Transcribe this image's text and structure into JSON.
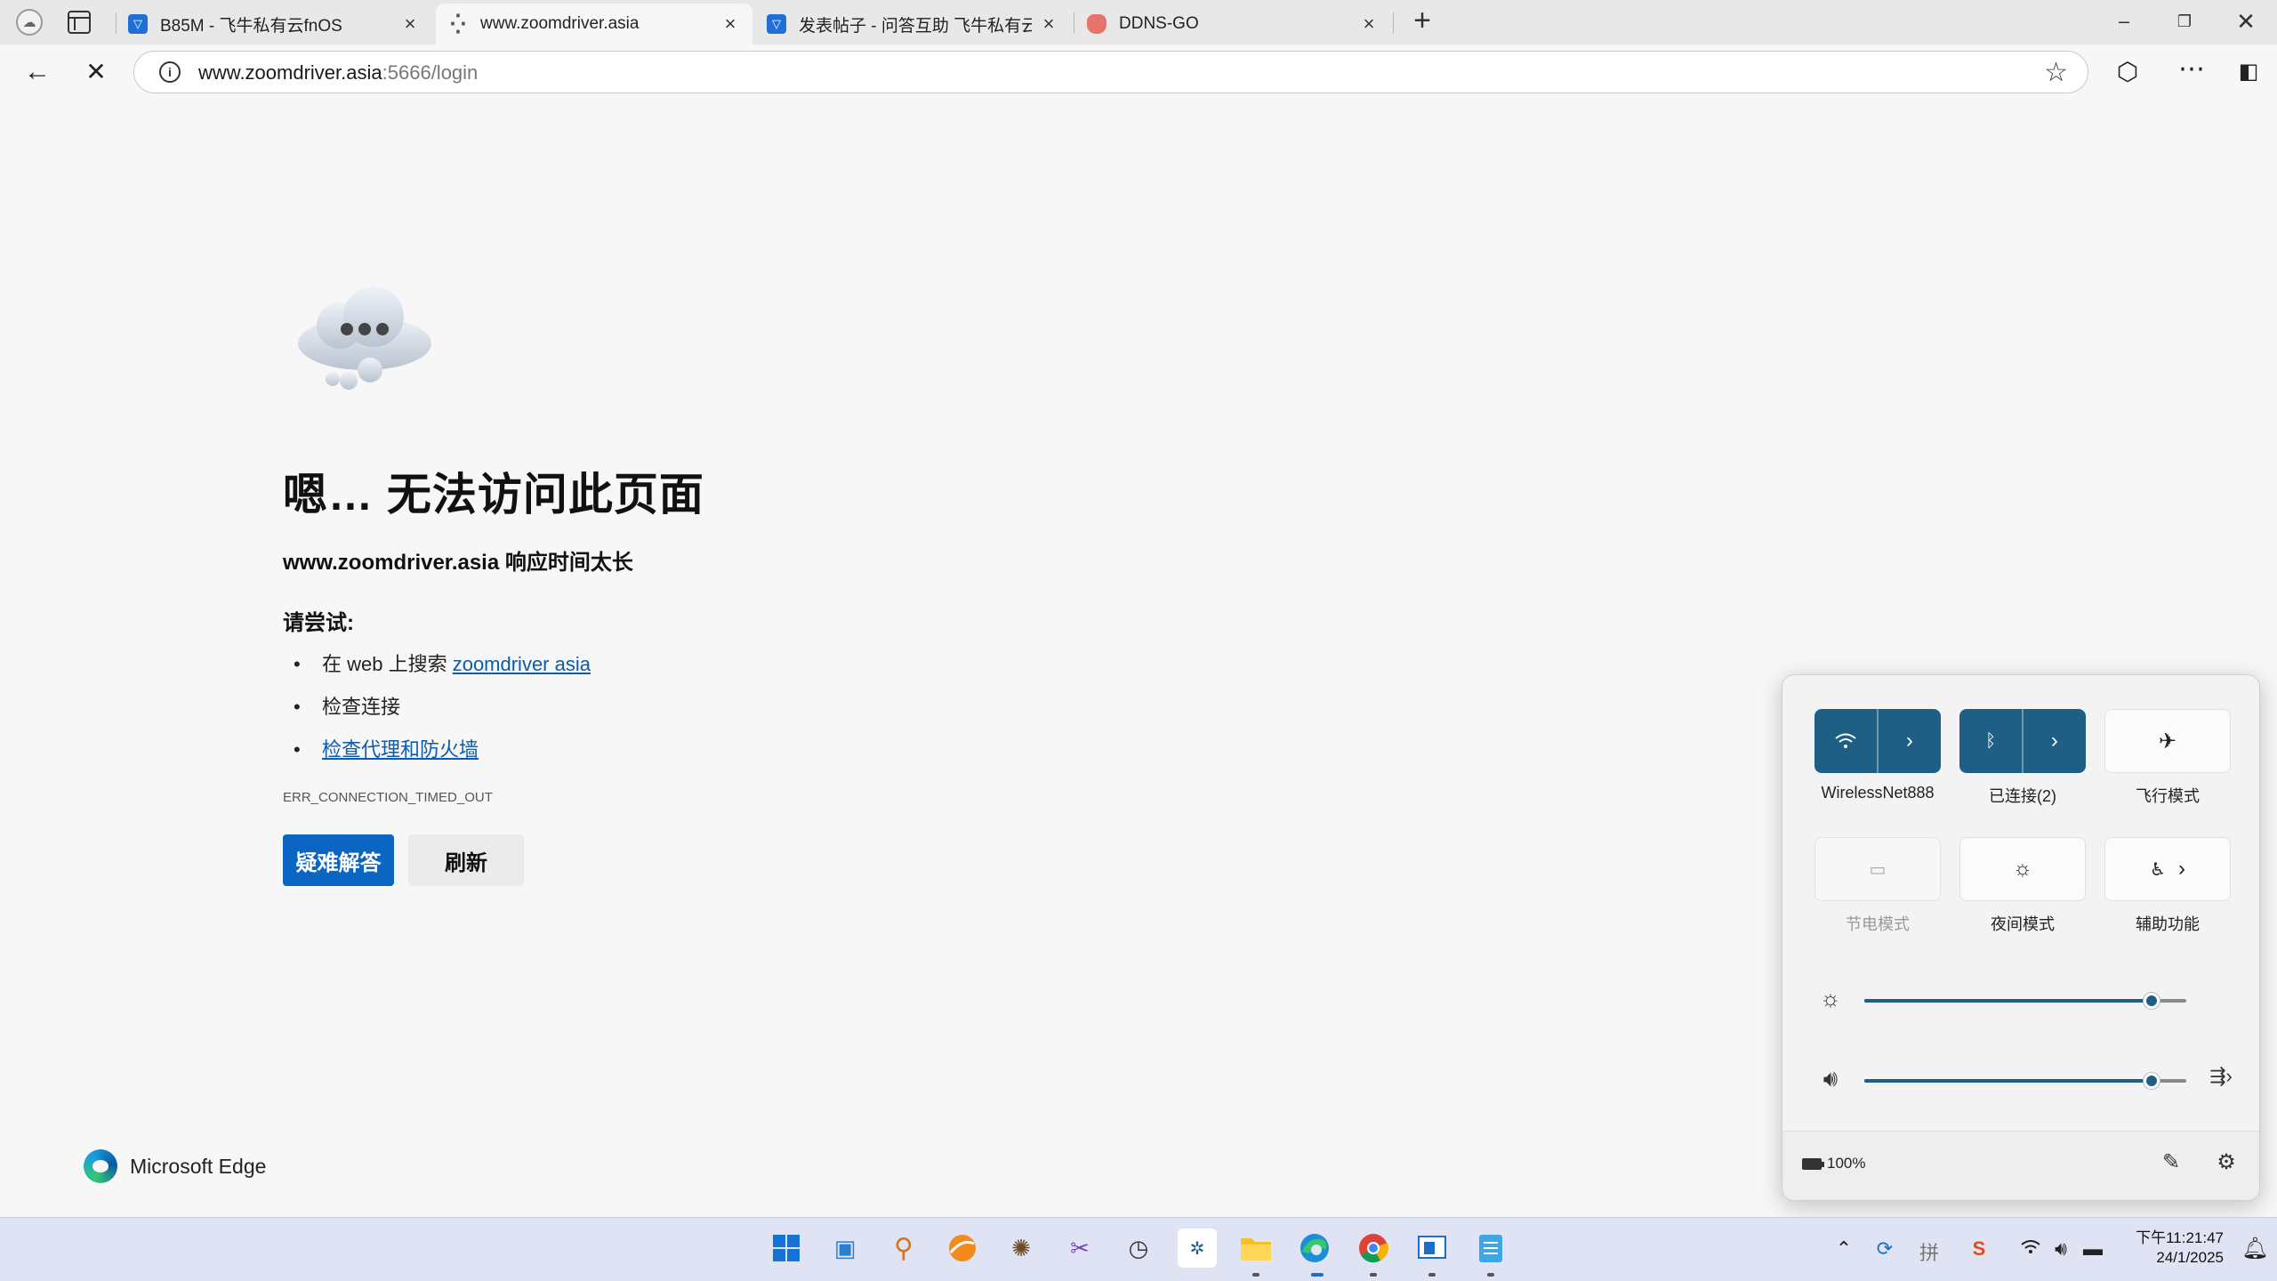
{
  "browser": {
    "tabs": [
      {
        "title": "B85M - 飞牛私有云fnOS",
        "favicon_color": "#1f6fd6",
        "active": false
      },
      {
        "title": "www.zoomdriver.asia",
        "favicon_color": "#555555",
        "active": true
      },
      {
        "title": "发表帖子 - 问答互助 飞牛私有云fnOS",
        "favicon_color": "#1f6fd6",
        "active": false
      },
      {
        "title": "DDNS-GO",
        "favicon_color": "#e7746c",
        "active": false
      }
    ],
    "address": {
      "host": "www.zoomdriver.asia",
      "path": ":5666/login"
    }
  },
  "error_page": {
    "title": "嗯… 无法访问此页面",
    "subtitle": "www.zoomdriver.asia 响应时间太长",
    "try_label": "请尝试:",
    "suggestions": {
      "search_prefix": "在 web 上搜索 ",
      "search_link": "zoomdriver asia",
      "check_connection": "检查连接",
      "check_proxy": "检查代理和防火墙"
    },
    "error_code": "ERR_CONNECTION_TIMED_OUT",
    "troubleshoot_button": "疑难解答",
    "refresh_button": "刷新",
    "brand": "Microsoft Edge"
  },
  "quick_settings": {
    "tiles": [
      {
        "label": "WirelessNet888",
        "icon": "wifi-icon",
        "state": "on"
      },
      {
        "label": "已连接(2)",
        "icon": "bluetooth-icon",
        "state": "on"
      },
      {
        "label": "飞行模式",
        "icon": "airplane-icon",
        "state": "off"
      },
      {
        "label": "节电模式",
        "icon": "battery-saver-icon",
        "state": "disabled"
      },
      {
        "label": "夜间模式",
        "icon": "night-light-icon",
        "state": "off"
      },
      {
        "label": "辅助功能",
        "icon": "accessibility-icon",
        "state": "off"
      }
    ],
    "brightness_level": 0.9,
    "volume_level": 0.9,
    "battery": "100%",
    "accent_color": "#1f5f85"
  },
  "taskbar": {
    "clock_time": "下午11:21:47",
    "clock_date": "24/1/2025"
  }
}
